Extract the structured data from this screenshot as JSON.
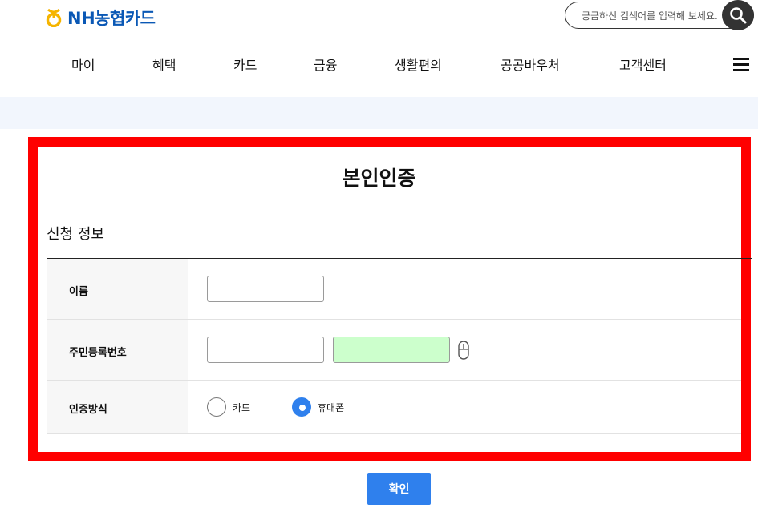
{
  "header": {
    "logo_text": "NH농협카드",
    "search_placeholder": "궁금하신 검색어를 입력해 보세요.",
    "nav": [
      "마이",
      "혜택",
      "카드",
      "금융",
      "생활편의",
      "공공바우처",
      "고객센터"
    ]
  },
  "colors": {
    "brand_blue": "#0a58b5",
    "logo_gold": "#f5b400",
    "highlight_red": "#ff0000",
    "accent_blue": "#2f80ed",
    "masked_field_green": "#ccffcc"
  },
  "page": {
    "title": "본인인증",
    "section_title": "신청 정보"
  },
  "form": {
    "name_label": "이름",
    "name_value": "",
    "rrn_label": "주민등록번호",
    "rrn_front_value": "",
    "rrn_back_value": "",
    "auth_label": "인증방식",
    "auth_options": [
      "카드",
      "휴대폰"
    ],
    "auth_selected": "휴대폰"
  },
  "buttons": {
    "confirm": "확인"
  }
}
